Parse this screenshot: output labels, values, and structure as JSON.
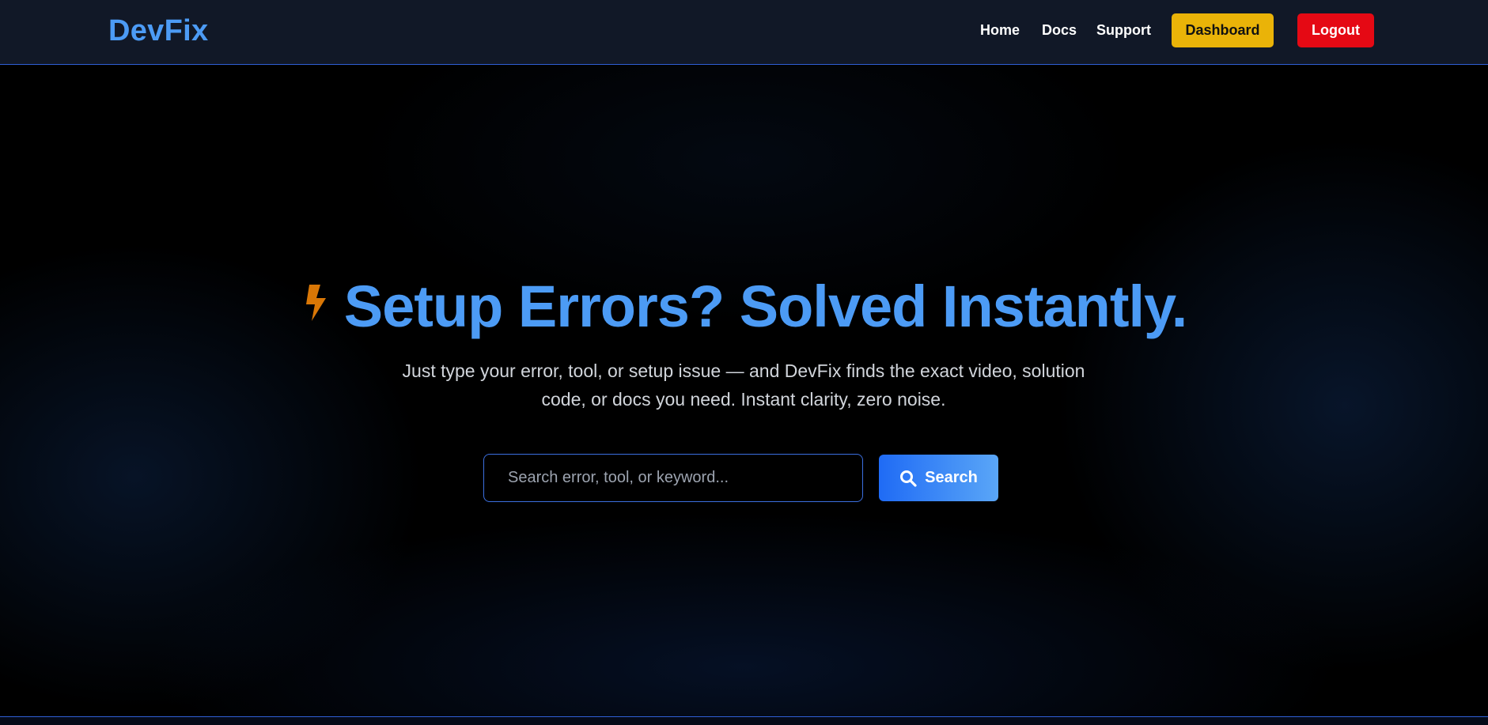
{
  "header": {
    "logo": "DevFix",
    "nav": {
      "home": "Home",
      "docs": "Docs",
      "support": "Support",
      "dashboard": "Dashboard",
      "logout": "Logout"
    }
  },
  "hero": {
    "icon": "lightning-bolt-icon",
    "headline": "Setup Errors? Solved Instantly.",
    "subtitle_line1": "Just type your error, tool, or setup issue — and DevFix finds the exact video, solution",
    "subtitle_line2": "code, or docs you need. Instant clarity, zero noise.",
    "search": {
      "placeholder": "Search error, tool, or keyword...",
      "value": "",
      "button_label": "Search",
      "button_icon": "search-icon"
    }
  },
  "colors": {
    "accent": "#4c9bf5",
    "nav_background": "#111827",
    "dashboard_button": "#eab308",
    "logout_button": "#e50914",
    "bolt": "#d97706"
  }
}
